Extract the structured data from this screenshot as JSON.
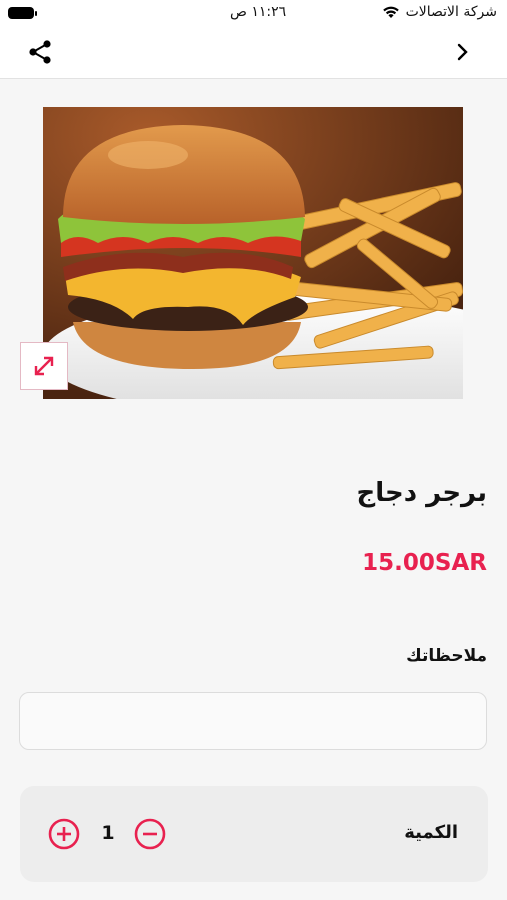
{
  "status_bar": {
    "carrier": "شركة الاتصالات",
    "time": "١١:٢٦ ص"
  },
  "product": {
    "name": "برجر دجاج",
    "price": "15.00SAR"
  },
  "notes": {
    "label": "ملاحظاتك",
    "value": ""
  },
  "quantity": {
    "label": "الكمية",
    "value": "1"
  },
  "icons": {
    "share": "share-icon",
    "back": "chevron-right-icon",
    "expand": "expand-icon",
    "plus": "plus-circle-icon",
    "minus": "minus-circle-icon"
  },
  "colors": {
    "accent": "#e8214f",
    "background": "#f6f6f6"
  }
}
